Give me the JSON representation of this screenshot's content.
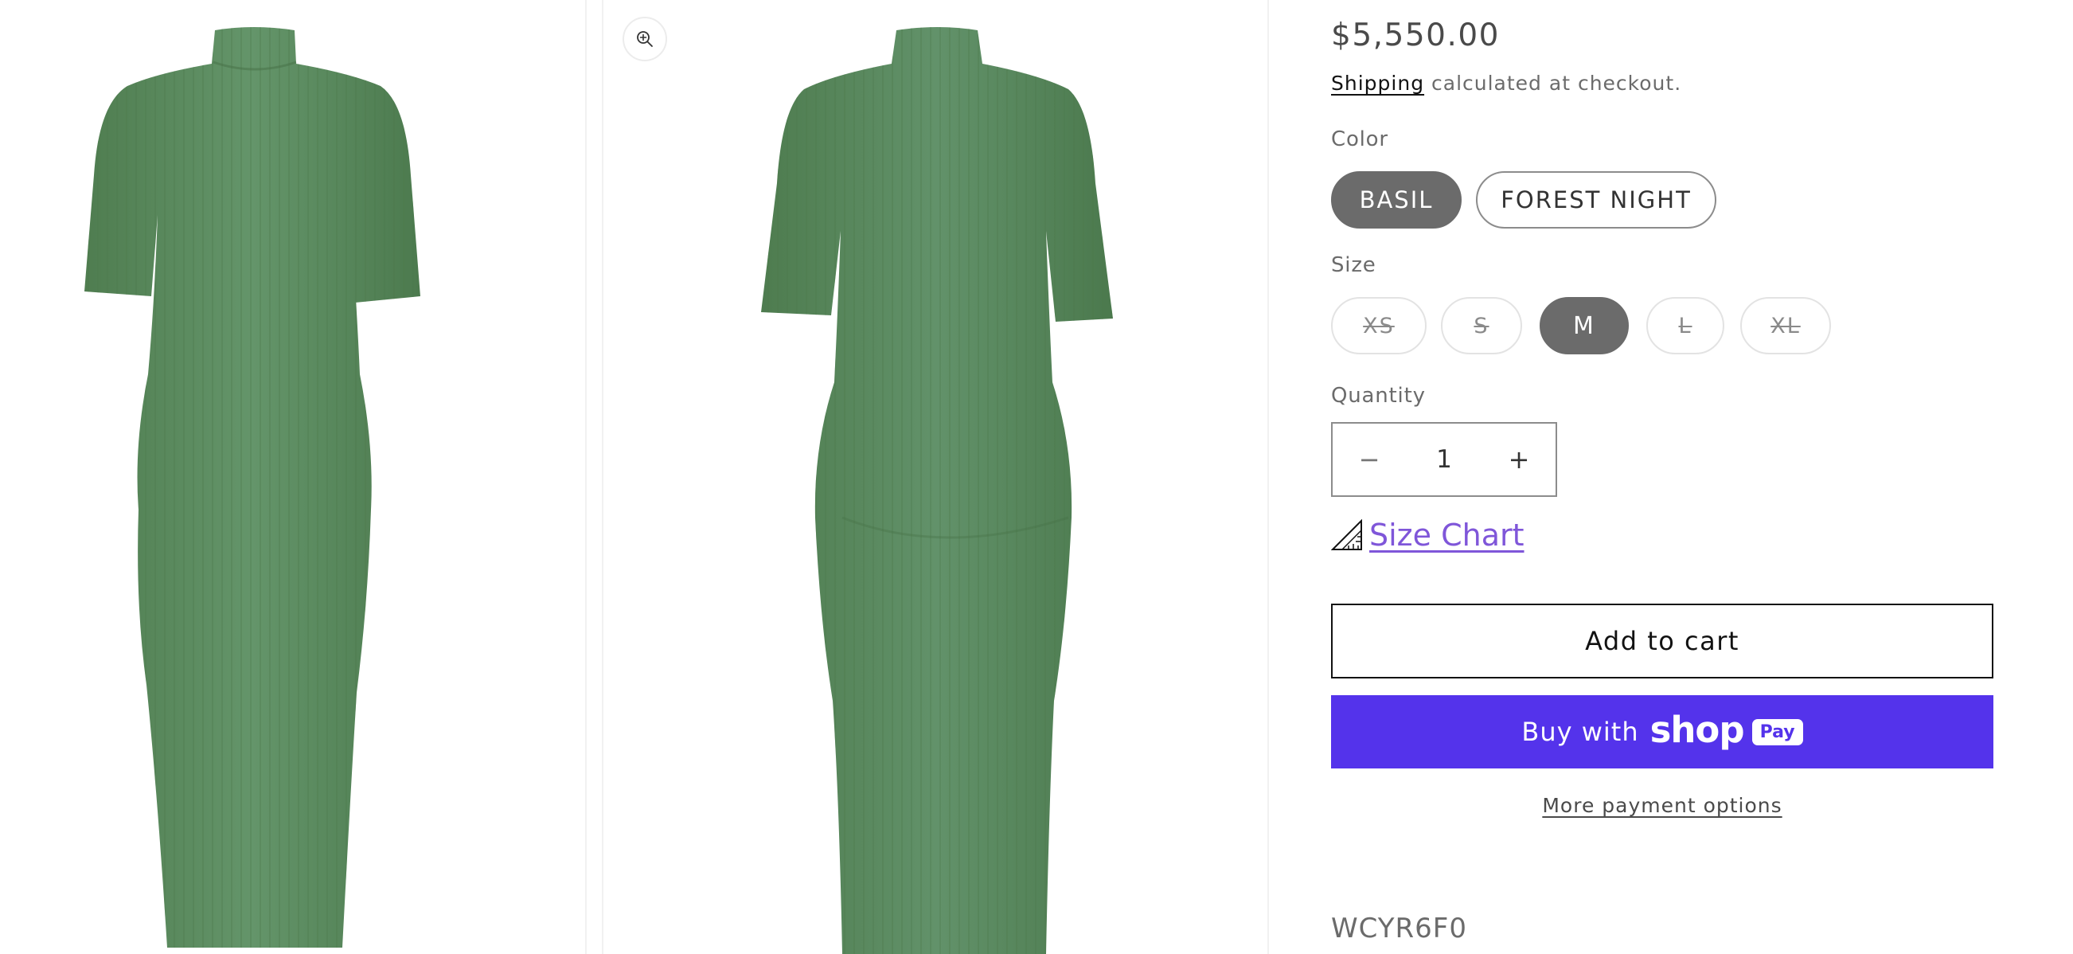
{
  "gallery": {
    "zoom_icon": "zoom-in-icon",
    "images": [
      {
        "alt": "Green ribbed mock-neck midi dress, front view",
        "color": "#5d8c5d"
      },
      {
        "alt": "Green ribbed mock-neck midi dress, back view",
        "color": "#5d8c5d"
      }
    ]
  },
  "product": {
    "price": "$5,550.00",
    "shipping_link": "Shipping",
    "shipping_text": " calculated at checkout.",
    "color_label": "Color",
    "colors": [
      {
        "label": "BASIL",
        "selected": true
      },
      {
        "label": "FOREST NIGHT",
        "selected": false
      }
    ],
    "size_label": "Size",
    "sizes": [
      {
        "label": "XS",
        "available": false
      },
      {
        "label": "S",
        "available": false
      },
      {
        "label": "M",
        "selected": true
      },
      {
        "label": "L",
        "available": false
      },
      {
        "label": "XL",
        "available": false
      }
    ],
    "quantity_label": "Quantity",
    "quantity": {
      "minus": "−",
      "value": "1",
      "plus": "+"
    },
    "size_chart_icon": "ruler-triangle-icon",
    "size_chart_label": "Size Chart",
    "add_to_cart": "Add to cart",
    "buy_with": "Buy with",
    "shop_word": "shop",
    "pay_badge": "Pay",
    "more_payment_options": "More payment options",
    "sku": "WCYR6F0"
  },
  "colors": {
    "accent_purple": "#5433eb",
    "size_chart_link": "#7f56d9",
    "selected_pill": "#6b6b6b",
    "dress_green": "#5d8c5d"
  }
}
